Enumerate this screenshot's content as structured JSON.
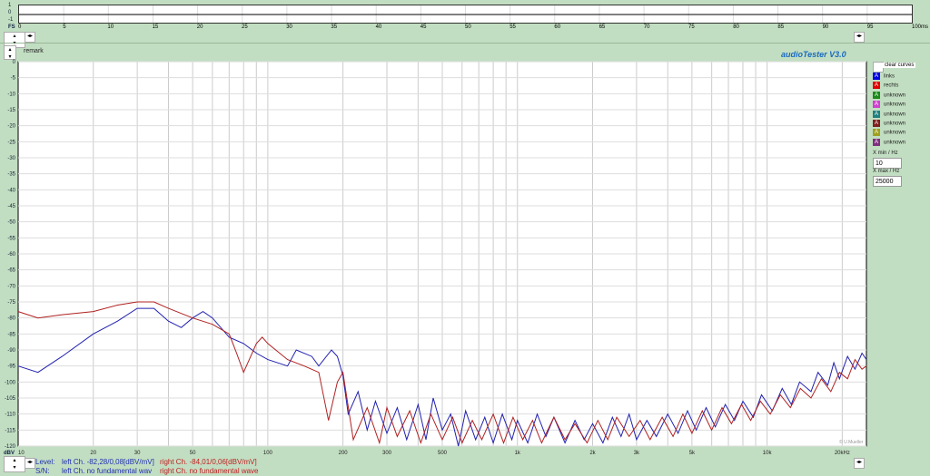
{
  "scope": {
    "y_labels": [
      "1",
      "0",
      "-1"
    ],
    "x_unit": "FS",
    "x_labels": [
      "0",
      "5",
      "10",
      "15",
      "20",
      "25",
      "30",
      "35",
      "40",
      "45",
      "50",
      "55",
      "60",
      "65",
      "70",
      "75",
      "80",
      "85",
      "90",
      "95",
      "100ms"
    ]
  },
  "remark": "remark",
  "title": "audioTester  V3.0",
  "watermark": "© U.Mueller",
  "clear_curves": "clear curves",
  "legend": [
    {
      "label": "links",
      "color": "#0000e0"
    },
    {
      "label": "rechts",
      "color": "#e00000"
    },
    {
      "label": "unknown",
      "color": "#1a8a1a"
    },
    {
      "label": "unknown",
      "color": "#d040d0"
    },
    {
      "label": "unknown",
      "color": "#208080"
    },
    {
      "label": "unknown",
      "color": "#802020"
    },
    {
      "label": "unknown",
      "color": "#a0a020"
    },
    {
      "label": "unknown",
      "color": "#803080"
    }
  ],
  "xmin": {
    "label": "X min / Hz",
    "value": "10"
  },
  "xmax": {
    "label": "X max / Hz",
    "value": "25000"
  },
  "info": {
    "level_label": "Level:",
    "sn_label": "S/N:",
    "level_left": "left Ch. -82,28/0,08[dBV/mV]",
    "level_right": "right Ch. -84,01/0,06[dBV/mV]",
    "sn_left": "left Ch.  no fundamental wav",
    "sn_right": "right Ch.  no fundamental wave"
  },
  "chart_data": {
    "type": "line",
    "xscale": "log",
    "xlim": [
      10,
      25000
    ],
    "ylim": [
      -120,
      0
    ],
    "ylabel": "dBV",
    "grid": true,
    "y_ticks": [
      "0",
      "-5",
      "-10",
      "-15",
      "-20",
      "-25",
      "-30",
      "-35",
      "-40",
      "-45",
      "-50",
      "-55",
      "-60",
      "-65",
      "-70",
      "-75",
      "-80",
      "-85",
      "-90",
      "-95",
      "-100",
      "-105",
      "-110",
      "-115",
      "-120"
    ],
    "x_ticks": [
      {
        "v": 10,
        "t": "10"
      },
      {
        "v": 20,
        "t": "20"
      },
      {
        "v": 30,
        "t": "30"
      },
      {
        "v": 50,
        "t": "50"
      },
      {
        "v": 100,
        "t": "100"
      },
      {
        "v": 200,
        "t": "200"
      },
      {
        "v": 300,
        "t": "300"
      },
      {
        "v": 500,
        "t": "500"
      },
      {
        "v": 1000,
        "t": "1k"
      },
      {
        "v": 2000,
        "t": "2k"
      },
      {
        "v": 3000,
        "t": "3k"
      },
      {
        "v": 5000,
        "t": "5k"
      },
      {
        "v": 10000,
        "t": "10k"
      },
      {
        "v": 20000,
        "t": "20kHz"
      }
    ],
    "series": [
      {
        "color": "#2020b0",
        "points": [
          [
            10,
            -95
          ],
          [
            12,
            -97
          ],
          [
            15,
            -92
          ],
          [
            20,
            -85
          ],
          [
            25,
            -81
          ],
          [
            30,
            -77
          ],
          [
            35,
            -77
          ],
          [
            40,
            -81
          ],
          [
            45,
            -83
          ],
          [
            50,
            -80
          ],
          [
            55,
            -78
          ],
          [
            60,
            -80
          ],
          [
            70,
            -86
          ],
          [
            80,
            -88
          ],
          [
            90,
            -91
          ],
          [
            100,
            -93
          ],
          [
            120,
            -95
          ],
          [
            130,
            -90
          ],
          [
            150,
            -92
          ],
          [
            160,
            -95
          ],
          [
            180,
            -90
          ],
          [
            190,
            -92
          ],
          [
            200,
            -98
          ],
          [
            210,
            -110
          ],
          [
            230,
            -103
          ],
          [
            250,
            -115
          ],
          [
            270,
            -106
          ],
          [
            300,
            -116
          ],
          [
            330,
            -108
          ],
          [
            360,
            -118
          ],
          [
            400,
            -107
          ],
          [
            430,
            -118
          ],
          [
            460,
            -105
          ],
          [
            500,
            -115
          ],
          [
            540,
            -110
          ],
          [
            580,
            -120
          ],
          [
            620,
            -109
          ],
          [
            680,
            -118
          ],
          [
            740,
            -111
          ],
          [
            800,
            -119
          ],
          [
            870,
            -110
          ],
          [
            950,
            -118
          ],
          [
            1000,
            -112
          ],
          [
            1100,
            -119
          ],
          [
            1200,
            -110
          ],
          [
            1300,
            -117
          ],
          [
            1400,
            -111
          ],
          [
            1550,
            -119
          ],
          [
            1700,
            -112
          ],
          [
            1850,
            -118
          ],
          [
            2000,
            -113
          ],
          [
            2200,
            -119
          ],
          [
            2400,
            -111
          ],
          [
            2600,
            -117
          ],
          [
            2800,
            -110
          ],
          [
            3000,
            -118
          ],
          [
            3300,
            -112
          ],
          [
            3600,
            -117
          ],
          [
            4000,
            -110
          ],
          [
            4400,
            -116
          ],
          [
            4800,
            -109
          ],
          [
            5200,
            -115
          ],
          [
            5700,
            -108
          ],
          [
            6200,
            -114
          ],
          [
            6800,
            -107
          ],
          [
            7400,
            -112
          ],
          [
            8000,
            -106
          ],
          [
            8800,
            -111
          ],
          [
            9500,
            -104
          ],
          [
            10500,
            -109
          ],
          [
            11500,
            -102
          ],
          [
            12500,
            -107
          ],
          [
            13500,
            -100
          ],
          [
            15000,
            -103
          ],
          [
            16000,
            -97
          ],
          [
            17500,
            -101
          ],
          [
            18500,
            -94
          ],
          [
            19500,
            -99
          ],
          [
            21000,
            -92
          ],
          [
            22500,
            -96
          ],
          [
            24000,
            -91
          ],
          [
            25000,
            -93
          ]
        ]
      },
      {
        "color": "#b02020",
        "points": [
          [
            10,
            -78
          ],
          [
            12,
            -80
          ],
          [
            15,
            -79
          ],
          [
            20,
            -78
          ],
          [
            25,
            -76
          ],
          [
            30,
            -75
          ],
          [
            35,
            -75
          ],
          [
            40,
            -77
          ],
          [
            50,
            -80
          ],
          [
            60,
            -82
          ],
          [
            70,
            -85
          ],
          [
            75,
            -91
          ],
          [
            80,
            -97
          ],
          [
            90,
            -88
          ],
          [
            95,
            -86
          ],
          [
            100,
            -88
          ],
          [
            120,
            -93
          ],
          [
            140,
            -95
          ],
          [
            160,
            -97
          ],
          [
            175,
            -112
          ],
          [
            190,
            -100
          ],
          [
            200,
            -97
          ],
          [
            220,
            -118
          ],
          [
            250,
            -108
          ],
          [
            280,
            -119
          ],
          [
            300,
            -108
          ],
          [
            330,
            -117
          ],
          [
            370,
            -109
          ],
          [
            410,
            -119
          ],
          [
            450,
            -110
          ],
          [
            500,
            -118
          ],
          [
            550,
            -111
          ],
          [
            600,
            -119
          ],
          [
            660,
            -112
          ],
          [
            720,
            -118
          ],
          [
            800,
            -110
          ],
          [
            880,
            -119
          ],
          [
            960,
            -111
          ],
          [
            1050,
            -118
          ],
          [
            1150,
            -112
          ],
          [
            1250,
            -119
          ],
          [
            1400,
            -111
          ],
          [
            1550,
            -118
          ],
          [
            1700,
            -113
          ],
          [
            1900,
            -119
          ],
          [
            2100,
            -112
          ],
          [
            2300,
            -118
          ],
          [
            2500,
            -111
          ],
          [
            2800,
            -117
          ],
          [
            3100,
            -112
          ],
          [
            3400,
            -118
          ],
          [
            3800,
            -111
          ],
          [
            4200,
            -117
          ],
          [
            4600,
            -110
          ],
          [
            5000,
            -116
          ],
          [
            5500,
            -109
          ],
          [
            6000,
            -115
          ],
          [
            6600,
            -108
          ],
          [
            7200,
            -113
          ],
          [
            7900,
            -107
          ],
          [
            8600,
            -112
          ],
          [
            9400,
            -106
          ],
          [
            10300,
            -110
          ],
          [
            11300,
            -104
          ],
          [
            12400,
            -108
          ],
          [
            13600,
            -102
          ],
          [
            15000,
            -105
          ],
          [
            16500,
            -99
          ],
          [
            18000,
            -103
          ],
          [
            19500,
            -97
          ],
          [
            21000,
            -99
          ],
          [
            22500,
            -93
          ],
          [
            24000,
            -96
          ],
          [
            25000,
            -95
          ]
        ]
      }
    ]
  }
}
